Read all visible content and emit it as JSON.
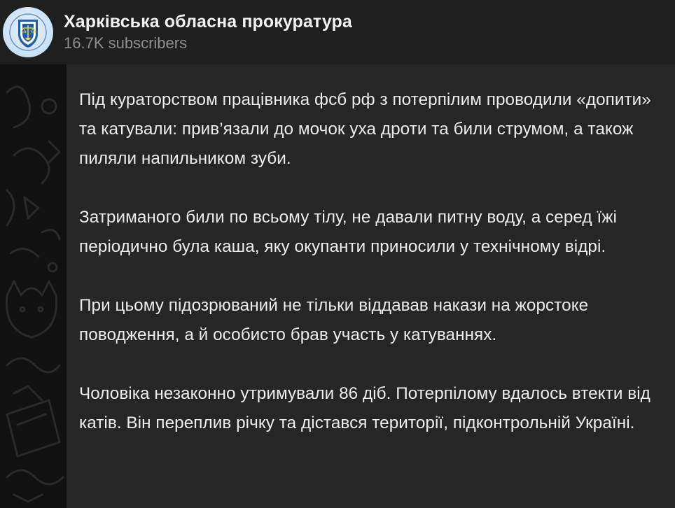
{
  "channel": {
    "title": "Харківська обласна прокуратура",
    "subscribers": "16.7K subscribers",
    "avatar_icon": "prosecutor-emblem-icon"
  },
  "message": {
    "paragraphs": [
      "Під кураторством працівника фсб рф з потерпілим проводили «допити» та катували: прив’язали до мочок уха дроти та били струмом, а також пиляли напильником зуби.",
      "Затриманого били по всьому тілу, не давали питну воду, а серед їжі періодично була каша, яку окупанти приносили у технічному відрі.",
      "При цьому підозрюваний не тільки віддавав накази на жорстоке поводження, а й особисто брав участь у катуваннях.",
      "Чоловіка незаконно утримували 86 діб. Потерпілому вдалось втекти від катів. Він переплив річку та дістався території, підконтрольній Україні."
    ]
  },
  "colors": {
    "header_bg": "#1f1f1f",
    "bubble_bg": "#262626",
    "text": "#ececec",
    "muted": "#8e8e8e",
    "avatar_blue": "#1f5fa8"
  }
}
